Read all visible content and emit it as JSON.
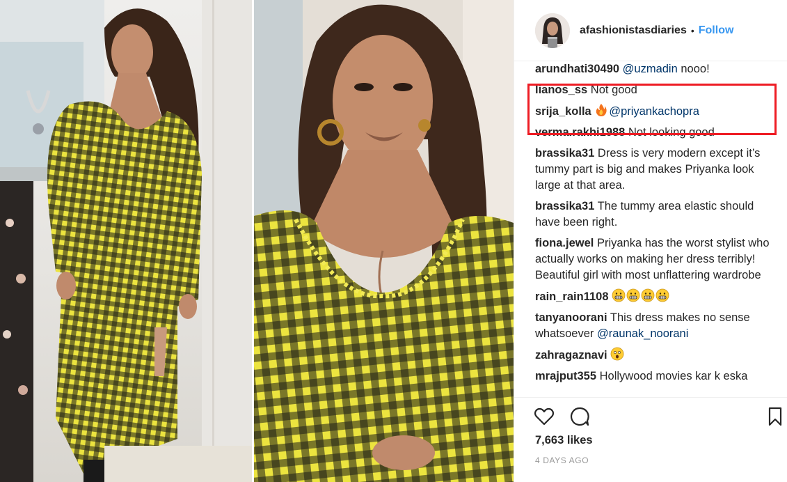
{
  "post": {
    "username": "afashionistasdiaries",
    "separator": "•",
    "follow_label": "Follow"
  },
  "comments": [
    {
      "user": "arundhati30490",
      "mention": "@uzmadin",
      "text": " nooo!"
    },
    {
      "user": "lianos_ss",
      "text": " Not good"
    },
    {
      "user": "srija_kolla",
      "emoji": "fire-emoji",
      "mention": "@priyankachopra"
    },
    {
      "user": "verma.rakhi1988",
      "text": " Not looking good"
    },
    {
      "user": "brassika31",
      "text": " Dress is very modern except it’s tummy part is big and makes Priyanka look large at that area.",
      "highlighted": true
    },
    {
      "user": "brassika31",
      "text": " The tummy area elastic should have been right."
    },
    {
      "user": "fiona.jewel",
      "text": " Priyanka has the worst stylist who actually works on making her dress terribly! Beautiful girl with most unflattering wardrobe"
    },
    {
      "user": "rain_rain1108",
      "emojis": [
        "grimacing-face-emoji",
        "grimacing-face-emoji",
        "grimacing-face-emoji",
        "grimacing-face-emoji"
      ]
    },
    {
      "user": "tanyanoorani",
      "text": " This dress makes no sense whatsoever ",
      "mention_after": "@raunak_noorani"
    },
    {
      "user": "zahragaznavi",
      "emoji": "astonished-face-emoji"
    },
    {
      "user": "mrajput355",
      "text": " Hollywood movies kar k eska"
    }
  ],
  "actions": {
    "icons": [
      "heart-icon",
      "comment-icon",
      "bookmark-icon"
    ],
    "likes": "7,663 likes",
    "timestamp": "4 DAYS AGO"
  },
  "colors": {
    "highlight_border": "#ee1c24",
    "follow_blue": "#3897f0",
    "mention_blue": "#003569",
    "text": "#262626",
    "meta_gray": "#999999",
    "gingham_yellow": "#e9e13c",
    "gingham_dark": "#1d1d17"
  }
}
